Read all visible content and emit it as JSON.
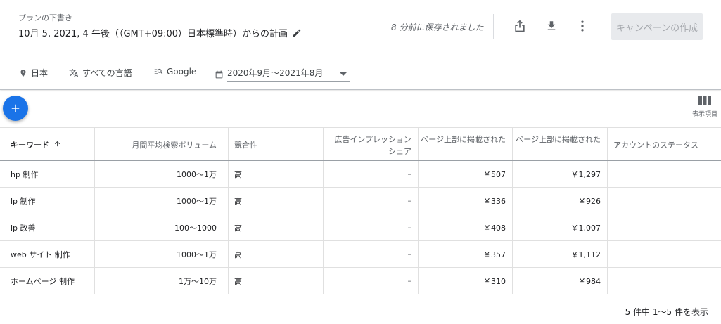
{
  "header": {
    "draft_label": "プランの下書き",
    "plan_title": "10月 5, 2021, 4 午後（（GMT+09:00）日本標準時）からの計画",
    "saved_text": "8 分前に保存されました",
    "create_button": "キャンペーンの作成"
  },
  "filters": {
    "location": "日本",
    "language": "すべての言語",
    "network": "Google",
    "date_range": "2020年9月〜2021年8月"
  },
  "toolbar": {
    "columns_label": "表示項目"
  },
  "table": {
    "headers": {
      "keyword": "キーワード",
      "volume": "月間平均検索ボリューム",
      "competition": "競合性",
      "impression_share": "広告インプレッション シェア",
      "top_bid_low": "ページ上部に掲載された",
      "top_bid_high": "ページ上部に掲載された",
      "account_status": "アカウントのステータス"
    },
    "rows": [
      {
        "keyword": "hp 制作",
        "volume": "1000〜1万",
        "competition": "高",
        "share": "–",
        "low": "￥507",
        "high": "￥1,297",
        "status": ""
      },
      {
        "keyword": "lp 制作",
        "volume": "1000〜1万",
        "competition": "高",
        "share": "–",
        "low": "￥336",
        "high": "￥926",
        "status": ""
      },
      {
        "keyword": "lp 改善",
        "volume": "100〜1000",
        "competition": "高",
        "share": "–",
        "low": "￥408",
        "high": "￥1,007",
        "status": ""
      },
      {
        "keyword": "web サイト 制作",
        "volume": "1000〜1万",
        "competition": "高",
        "share": "–",
        "low": "￥357",
        "high": "￥1,112",
        "status": ""
      },
      {
        "keyword": "ホームページ 制作",
        "volume": "1万〜10万",
        "competition": "高",
        "share": "–",
        "low": "￥310",
        "high": "￥984",
        "status": ""
      }
    ]
  },
  "pagination": "5 件中 1〜5 件を表示",
  "colors": {
    "accent": "#1a73e8",
    "border": "#e0e0e0",
    "muted_text": "#5f6368"
  },
  "icons": [
    "pencil-icon",
    "share-icon",
    "download-icon",
    "more-vert-icon",
    "location-icon",
    "translate-icon",
    "search-network-icon",
    "calendar-icon",
    "add-icon",
    "columns-icon",
    "sort-arrow-up-icon"
  ]
}
